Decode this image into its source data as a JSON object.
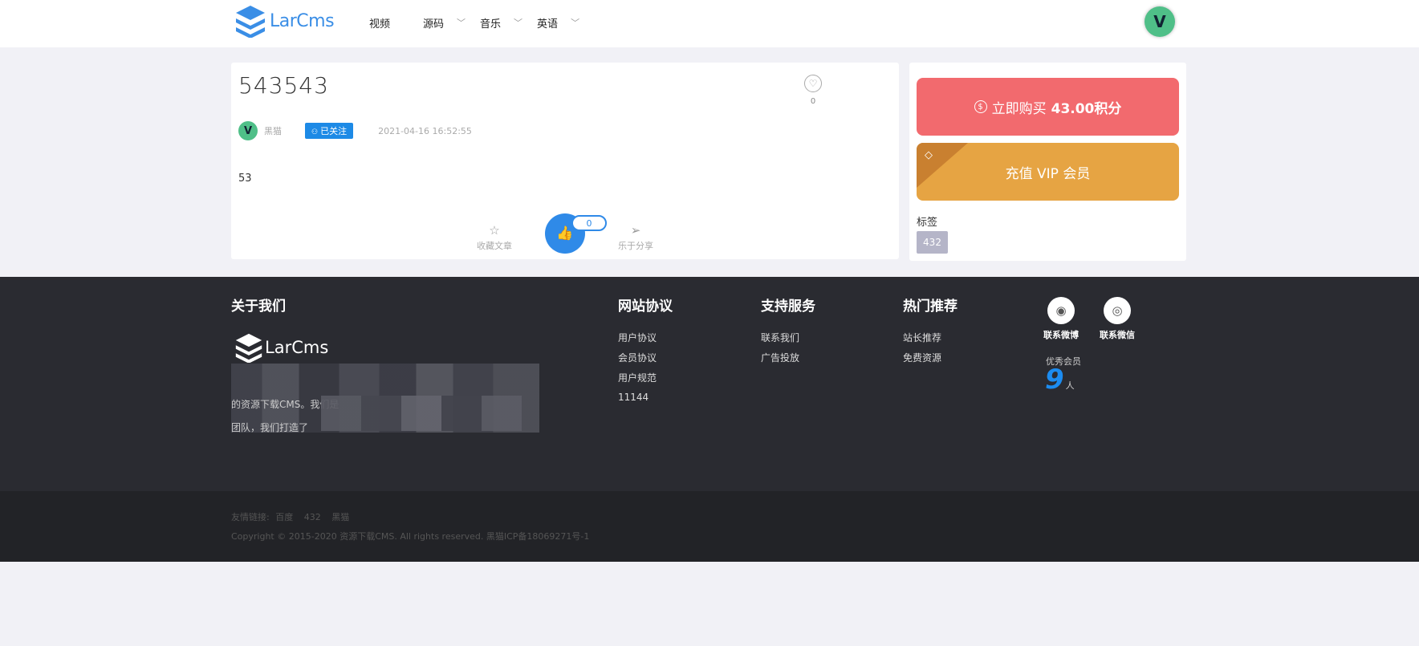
{
  "header": {
    "logo_text": "LarCms",
    "nav": [
      {
        "label": "视频",
        "has_dropdown": false
      },
      {
        "label": "源码",
        "has_dropdown": true
      },
      {
        "label": "音乐",
        "has_dropdown": true
      },
      {
        "label": "英语",
        "has_dropdown": true
      }
    ],
    "user_avatar_letter": "V"
  },
  "post": {
    "title": "543543",
    "favorite_count": "0",
    "author_avatar_letter": "V",
    "author": "黑猫",
    "follow_label": "已关注",
    "date": "2021-04-16 16:52:55",
    "body": "53",
    "collect_label": "收藏文章",
    "like_count": "0",
    "share_label": "乐于分享"
  },
  "sidebar": {
    "buy_label": "立即购买",
    "buy_price": "43.00积分",
    "vip_label": "充值 VIP 会员",
    "tags_title": "标签",
    "tags": [
      "432"
    ]
  },
  "footer": {
    "about_title": "关于我们",
    "logo_text": "LarCms",
    "about_line1": "的资源下载CMS。我们是",
    "about_line2": "团队，我们打造了",
    "col1": {
      "title": "网站协议",
      "links": [
        "用户协议",
        "会员协议",
        "用户规范",
        "11144"
      ]
    },
    "col2": {
      "title": "支持服务",
      "links": [
        "联系我们",
        "广告投放"
      ]
    },
    "col3": {
      "title": "热门推荐",
      "links": [
        "站长推荐",
        "免费资源"
      ]
    },
    "weibo_label": "联系微博",
    "wechat_label": "联系微信",
    "vip_members_label": "优秀会员",
    "vip_members_count": "9",
    "vip_members_unit": "人"
  },
  "bottom": {
    "friend_links_label": "友情链接:",
    "friend_links": [
      "百度",
      "432",
      "黑猫"
    ],
    "copyright": "Copyright © 2015-2020 资源下载CMS. All rights reserved. 黑猫ICP备18069271号-1"
  },
  "colors": {
    "accent_blue": "#2f8ae8",
    "buy_red": "#f26a6e",
    "vip_orange": "#e6a443",
    "footer_bg": "#2a2b31"
  }
}
